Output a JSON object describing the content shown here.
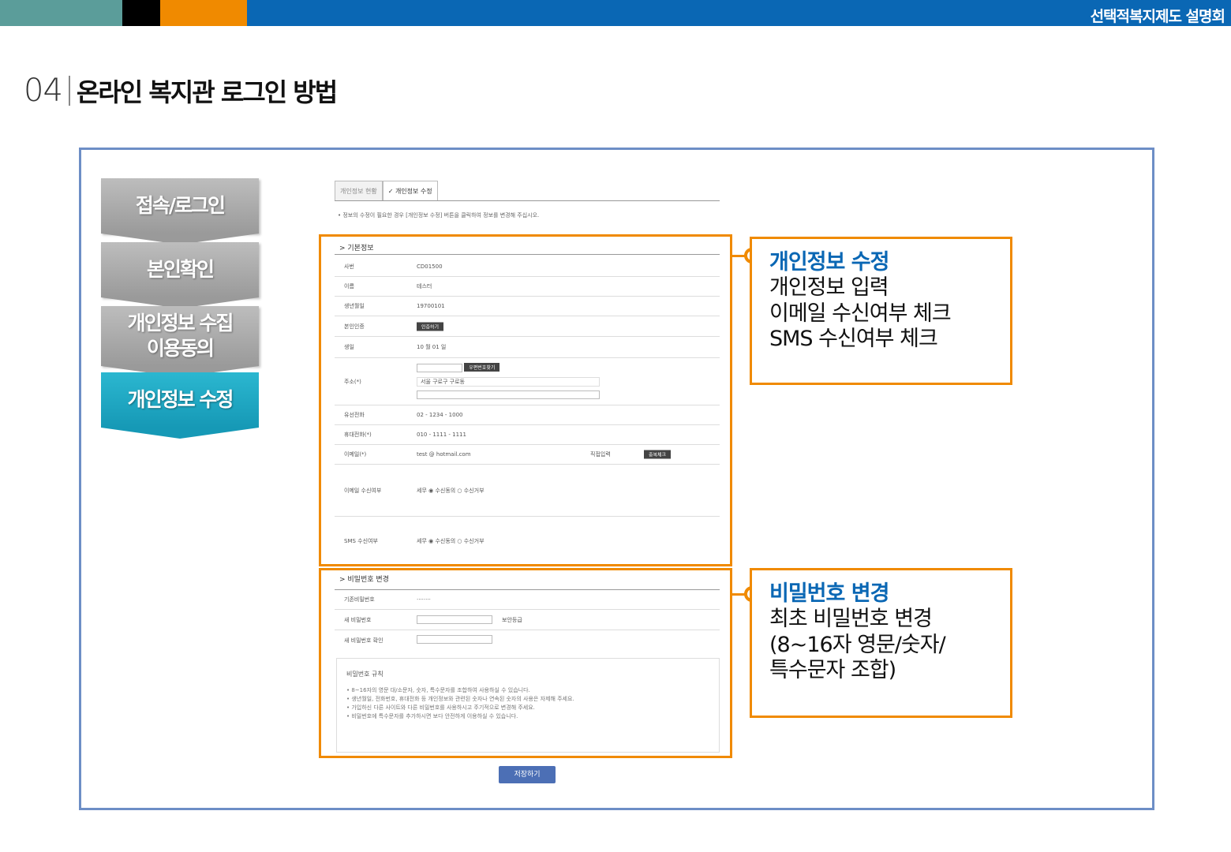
{
  "header": {
    "title": "선택적복지제도 설명회"
  },
  "heading": {
    "num": "04",
    "title": "온라인 복지관 로그인 방법"
  },
  "steps": [
    {
      "label": "접속/로그인"
    },
    {
      "label": "본인확인"
    },
    {
      "label_line1": "개인정보 수집",
      "label_line2": "이용동의"
    },
    {
      "label": "개인정보 수정"
    }
  ],
  "form": {
    "tabs": [
      "개인정보 현황",
      "✓ 개인정보 수정"
    ],
    "notice": "• 정보의 수정이 필요한 경우 [개인정보 수정] 버튼을 클릭하여 정보를 변경해 주십시오.",
    "basic_title": "> 기본정보",
    "rows": [
      {
        "label": "사번",
        "value": "CD01500"
      },
      {
        "label": "이름",
        "value": "테스터"
      },
      {
        "label": "생년월일",
        "value": "19700101"
      },
      {
        "label": "본인인증",
        "value": "인증하기"
      },
      {
        "label": "생일",
        "value": "10 월 01 일"
      },
      {
        "label": "주소(*)",
        "value": "서울 구로구 구로동"
      },
      {
        "label": "유선전화",
        "value": "02 - 1234 - 1000"
      },
      {
        "label": "휴대전화(*)",
        "value": "010 - 1111 - 1111"
      },
      {
        "label": "이메일(*)",
        "value": "test @ hotmail.com"
      },
      {
        "label": "이메일 수신여부",
        "value": "세무 ◉ 수신동의 ○ 수신거부"
      },
      {
        "label": "SMS 수신여부",
        "value": "세무 ◉ 수신동의 ○ 수신거부"
      }
    ],
    "email_domain_select": "직접입력",
    "address_button": "우편번호찾기",
    "email_check_button": "중복체크",
    "password_title": "> 비밀번호 변경",
    "pw_rows": [
      {
        "label": "기존비밀번호",
        "value": "········"
      },
      {
        "label": "새 비밀번호",
        "value": "보안등급"
      },
      {
        "label": "새 비밀번호 확인",
        "value": ""
      }
    ],
    "pw_rules_title": "비밀번호 규칙",
    "pw_rules": [
      "• 8~16자의 영문 대/소문자, 숫자, 특수문자를 조합하여 사용하실 수 있습니다.",
      "• 생년월일, 전화번호, 휴대전화 등 개인정보와 관련된 숫자나 연속된 숫자의 사용은 자제해 주세요.",
      "• 가입하신 다른 사이트와 다른 비밀번호를 사용하시고 주기적으로 변경해 주세요.",
      "• 비밀번호에 특수문자를 추가하시면 보다 안전하게 이용하실 수 있습니다."
    ],
    "save_button": "저장하기"
  },
  "callout1": {
    "title": "개인정보 수정",
    "lines": [
      "개인정보 입력",
      "이메일 수신여부 체크",
      "SMS 수신여부 체크"
    ]
  },
  "callout2": {
    "title": "비밀번호 변경",
    "lines": [
      "최초 비밀번호 변경",
      "(8~16자 영문/숫자/",
      "특수문자 조합)"
    ]
  },
  "colors": {
    "brand_blue": "#0a67b4",
    "accent_orange": "#f08a00",
    "step_teal": "#1699b6"
  }
}
